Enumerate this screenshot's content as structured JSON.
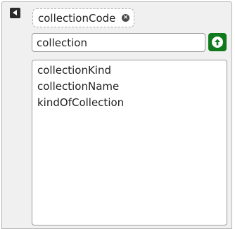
{
  "selected_tag": {
    "label": "collectionCode",
    "remove_icon": "close-circle-icon"
  },
  "search": {
    "value": "collection"
  },
  "submit_icon": "arrow-up-circle-icon",
  "suggestions": [
    "collectionKind",
    "collectionName",
    "kindOfCollection"
  ],
  "colors": {
    "submit_button": "#0f7a1c",
    "panel_background": "#f0f0f0"
  }
}
